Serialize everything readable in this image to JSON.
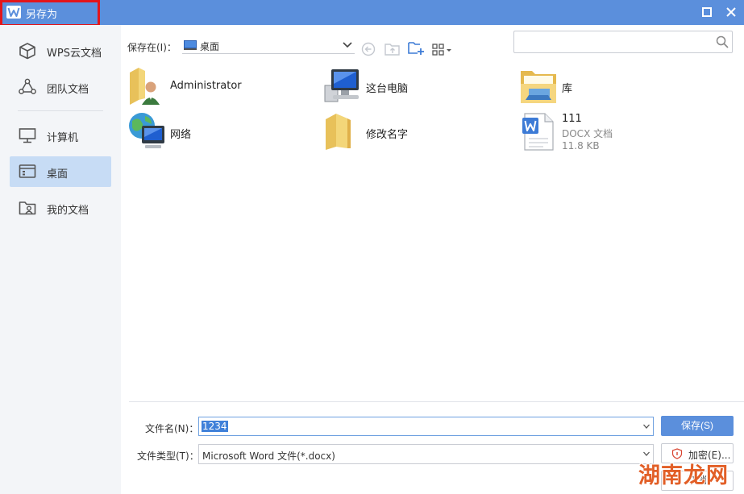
{
  "window": {
    "title": "另存为",
    "accent_color": "#5b8fdc",
    "highlight_color": "#e3151b"
  },
  "sidebar": {
    "items": [
      {
        "label": "WPS云文档",
        "icon": "cube-icon",
        "active": false
      },
      {
        "label": "团队文档",
        "icon": "team-icon",
        "active": false
      },
      {
        "label": "计算机",
        "icon": "monitor-icon",
        "active": false
      },
      {
        "label": "桌面",
        "icon": "desktop-icon",
        "active": true
      },
      {
        "label": "我的文档",
        "icon": "user-folder-icon",
        "active": false
      }
    ]
  },
  "toolbar": {
    "save_in_label": "保存在(I)：",
    "location": "桌面",
    "search_placeholder": ""
  },
  "files": [
    {
      "name": "Administrator",
      "icon": "user-folder-icon",
      "type": "",
      "size": ""
    },
    {
      "name": "这台电脑",
      "icon": "computer-icon",
      "type": "",
      "size": ""
    },
    {
      "name": "库",
      "icon": "library-icon",
      "type": "",
      "size": ""
    },
    {
      "name": "网络",
      "icon": "network-icon",
      "type": "",
      "size": ""
    },
    {
      "name": "修改名字",
      "icon": "folder-icon",
      "type": "",
      "size": ""
    },
    {
      "name": "111",
      "icon": "wps-doc-icon",
      "type": "DOCX 文档",
      "size": "11.8 KB"
    }
  ],
  "bottom": {
    "filename_label": "文件名(N)：",
    "filename_value": "1234",
    "filetype_label": "文件类型(T)：",
    "filetype_value": "Microsoft Word 文件(*.docx)",
    "save_button": "保存(S)",
    "encrypt_button": "加密(E)...",
    "cancel_button": "取消"
  },
  "watermark": "湖南龙网"
}
